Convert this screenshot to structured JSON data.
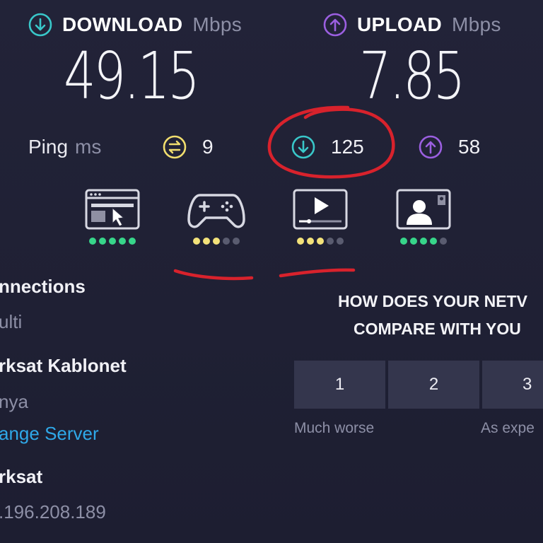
{
  "download": {
    "label": "DOWNLOAD",
    "unit": "Mbps",
    "value": "49.15",
    "icon": "arrow-down-circle-icon",
    "color": "#39c7c9"
  },
  "upload": {
    "label": "UPLOAD",
    "unit": "Mbps",
    "value": "7.85",
    "icon": "arrow-up-circle-icon",
    "color": "#9b5fe0"
  },
  "ping": {
    "label": "Ping",
    "unit": "ms",
    "idle": {
      "value": "9",
      "icon": "ping-idle-icon",
      "color": "#f1de6e"
    },
    "download": {
      "value": "125",
      "icon": "arrow-down-circle-icon",
      "color": "#39c7c9"
    },
    "upload": {
      "value": "58",
      "icon": "arrow-up-circle-icon",
      "color": "#9b5fe0"
    }
  },
  "quality": [
    {
      "name": "web-browsing-icon",
      "rating": 5,
      "of": 5,
      "color": "#37d58a"
    },
    {
      "name": "gaming-icon",
      "rating": 3,
      "of": 5,
      "color": "#f3e27a"
    },
    {
      "name": "streaming-icon",
      "rating": 3,
      "of": 5,
      "color": "#f3e27a"
    },
    {
      "name": "video-call-icon",
      "rating": 4,
      "of": 5,
      "color": "#37d58a"
    }
  ],
  "info": {
    "connections_title": "nnections",
    "connections_value": "ulti",
    "server_name": "rksat Kablonet",
    "server_city": "nya",
    "change_server": "ange Server",
    "provider": "rksat",
    "ip": ".196.208.189"
  },
  "compare": {
    "question_line1": "HOW DOES YOUR NETV",
    "question_line2": "COMPARE WITH YOU",
    "options": [
      "1",
      "2",
      "3"
    ],
    "scale_low": "Much worse",
    "scale_mid": "As expe"
  },
  "annotation_color": "#d8222c"
}
